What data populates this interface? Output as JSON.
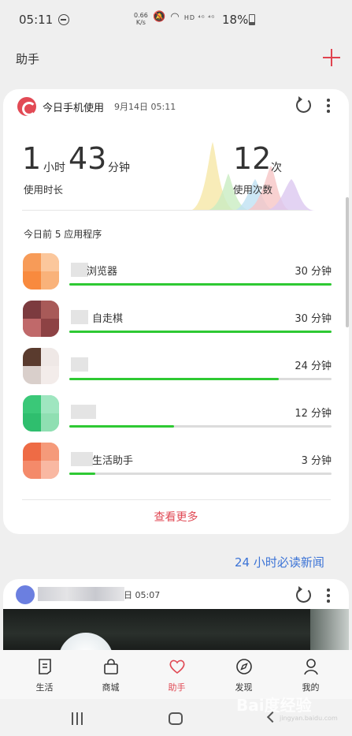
{
  "status_bar": {
    "time": "05:11",
    "net_speed_value": "0.66",
    "net_speed_unit": "K/s",
    "signal_text": "HD ⁴ᴳ ⁴ᴳ",
    "battery": "18%"
  },
  "header": {
    "title": "助手"
  },
  "usage_card": {
    "title": "今日手机使用",
    "date": "9月14日 05:11",
    "hours": "1",
    "hours_unit": "小时",
    "minutes": "43",
    "minutes_unit": "分钟",
    "duration_label": "使用时长",
    "count": "12",
    "count_unit": "次",
    "count_label": "使用次数",
    "section_title": "今日前 5 应用程序",
    "apps": [
      {
        "name": "浏览器",
        "duration": "30 分钟",
        "fraction": 1.0
      },
      {
        "name": "自走棋",
        "duration": "30 分钟",
        "fraction": 1.0
      },
      {
        "name": "",
        "duration": "24 分钟",
        "fraction": 0.8
      },
      {
        "name": "",
        "duration": "12 分钟",
        "fraction": 0.4
      },
      {
        "name": "生活助手",
        "duration": "3 分钟",
        "fraction": 0.1
      }
    ],
    "see_more": "查看更多"
  },
  "news_link": "24 小时必读新闻",
  "news_card": {
    "time": "日 05:07"
  },
  "bottom_nav": [
    {
      "label": "生活",
      "icon": "life-icon"
    },
    {
      "label": "商城",
      "icon": "shop-bag-icon"
    },
    {
      "label": "助手",
      "icon": "heart-icon",
      "active": true
    },
    {
      "label": "发现",
      "icon": "compass-icon"
    },
    {
      "label": "我的",
      "icon": "profile-icon"
    }
  ],
  "watermark": {
    "text": "Bai度经验",
    "sub": "jingyan.baidu.com"
  },
  "colors": {
    "accent": "#e04a55",
    "progress": "#2ec933",
    "link": "#3b73d6"
  }
}
